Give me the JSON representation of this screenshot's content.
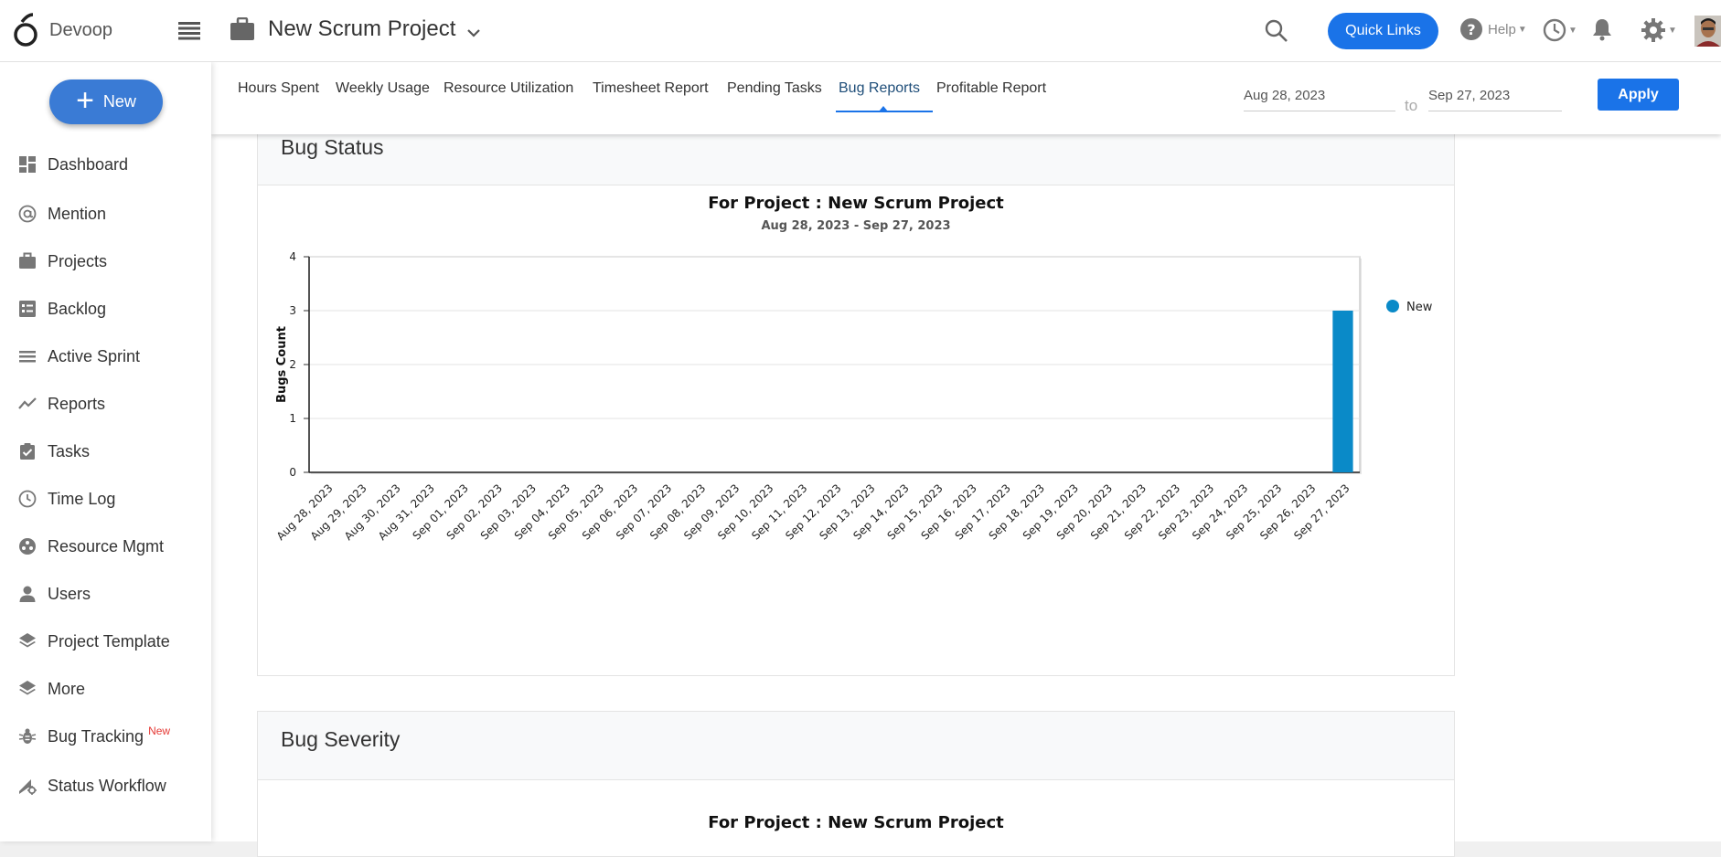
{
  "app": {
    "name": "Devoop"
  },
  "project": {
    "title": "New Scrum Project"
  },
  "header": {
    "quick_links": "Quick Links",
    "help": "Help"
  },
  "sidebar": {
    "new_label": "New",
    "items": [
      {
        "label": "Dashboard",
        "icon": "dashboard-icon"
      },
      {
        "label": "Mention",
        "icon": "at-icon"
      },
      {
        "label": "Projects",
        "icon": "briefcase-icon"
      },
      {
        "label": "Backlog",
        "icon": "backlog-icon"
      },
      {
        "label": "Active Sprint",
        "icon": "sprint-icon"
      },
      {
        "label": "Reports",
        "icon": "trend-icon"
      },
      {
        "label": "Tasks",
        "icon": "clipboard-check-icon"
      },
      {
        "label": "Time Log",
        "icon": "clock-icon"
      },
      {
        "label": "Resource Mgmt",
        "icon": "resource-icon"
      },
      {
        "label": "Users",
        "icon": "user-icon"
      },
      {
        "label": "Project Template",
        "icon": "layers-icon"
      },
      {
        "label": "More",
        "icon": "layers-icon"
      },
      {
        "label": "Bug Tracking",
        "icon": "bug-icon",
        "badge": "New"
      },
      {
        "label": "Status Workflow",
        "icon": "workflow-icon"
      }
    ]
  },
  "tabs": [
    {
      "label": "Hours Spent"
    },
    {
      "label": "Weekly Usage"
    },
    {
      "label": "Resource Utilization"
    },
    {
      "label": "Timesheet Report"
    },
    {
      "label": "Pending Tasks"
    },
    {
      "label": "Bug Reports",
      "active": true
    },
    {
      "label": "Profitable Report"
    }
  ],
  "date_range": {
    "from": "Aug 28, 2023",
    "to_label": "to",
    "to": "Sep 27, 2023",
    "apply": "Apply"
  },
  "sections": {
    "bug_status": {
      "title": "Bug Status"
    },
    "bug_severity": {
      "title": "Bug Severity",
      "chart_title": "For Project : New Scrum Project"
    }
  },
  "colors": {
    "accent": "#1a73e8",
    "series_new": "#0a8ac8"
  },
  "chart_data": {
    "type": "bar",
    "title": "For Project : New Scrum Project",
    "subtitle": "Aug 28, 2023 - Sep 27, 2023",
    "xlabel": "",
    "ylabel": "Bugs Count",
    "ylim": [
      0,
      4
    ],
    "yticks": [
      0,
      1,
      2,
      3,
      4
    ],
    "grid": true,
    "legend_position": "right",
    "categories": [
      "Aug 28, 2023",
      "Aug 29, 2023",
      "Aug 30, 2023",
      "Aug 31, 2023",
      "Sep 01, 2023",
      "Sep 02, 2023",
      "Sep 03, 2023",
      "Sep 04, 2023",
      "Sep 05, 2023",
      "Sep 06, 2023",
      "Sep 07, 2023",
      "Sep 08, 2023",
      "Sep 09, 2023",
      "Sep 10, 2023",
      "Sep 11, 2023",
      "Sep 12, 2023",
      "Sep 13, 2023",
      "Sep 14, 2023",
      "Sep 15, 2023",
      "Sep 16, 2023",
      "Sep 17, 2023",
      "Sep 18, 2023",
      "Sep 19, 2023",
      "Sep 20, 2023",
      "Sep 21, 2023",
      "Sep 22, 2023",
      "Sep 23, 2023",
      "Sep 24, 2023",
      "Sep 25, 2023",
      "Sep 26, 2023",
      "Sep 27, 2023"
    ],
    "series": [
      {
        "name": "New",
        "color": "#0a8ac8",
        "values": [
          0,
          0,
          0,
          0,
          0,
          0,
          0,
          0,
          0,
          0,
          0,
          0,
          0,
          0,
          0,
          0,
          0,
          0,
          0,
          0,
          0,
          0,
          0,
          0,
          0,
          0,
          0,
          0,
          0,
          0,
          3
        ]
      }
    ]
  }
}
